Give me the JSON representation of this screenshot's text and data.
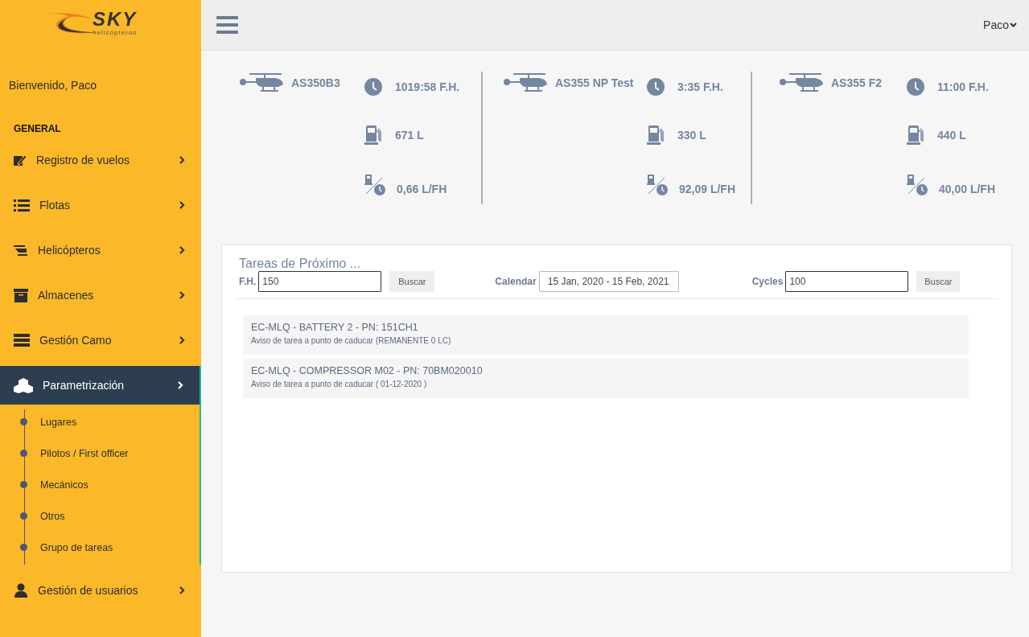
{
  "logo": {
    "name": "SKY",
    "tagline": "helicópteros"
  },
  "welcome": "Bienvenido, Paco",
  "section_heading": "GENERAL",
  "menu": [
    {
      "label": "Registro de vuelos",
      "selected": false
    },
    {
      "label": "Flotas",
      "selected": false
    },
    {
      "label": "Helicópteros",
      "selected": false
    },
    {
      "label": "Almacenes",
      "selected": false
    },
    {
      "label": "Gestión Camo",
      "selected": false
    },
    {
      "label": "Parametrización",
      "selected": true,
      "children": [
        {
          "label": "Lugares"
        },
        {
          "label": "Pilotos / First officer"
        },
        {
          "label": "Mecánicos"
        },
        {
          "label": "Otros"
        },
        {
          "label": "Grupo de tareas"
        }
      ]
    },
    {
      "label": "Gestión de usuarios",
      "selected": false
    }
  ],
  "user_menu": "Paco",
  "aircraft": [
    {
      "name": "AS350B3",
      "hours": "1019:58 F.H.",
      "fuel": "671 L",
      "consumption": "0,66 L/FH"
    },
    {
      "name": "AS355 NP Test",
      "hours": "3:35 F.H.",
      "fuel": "330 L",
      "consumption": "92,09 L/FH"
    },
    {
      "name": "AS355 F2",
      "hours": "11:00 F.H.",
      "fuel": "440 L",
      "consumption": "40,00 L/FH"
    }
  ],
  "tasks_panel": {
    "title": "Tareas de Próximo ...",
    "filters": [
      {
        "label": "F.H.",
        "value": "150",
        "button": "Buscar"
      },
      {
        "label": "Calendar",
        "value": "15 Jan, 2020 - 15 Feb, 2021"
      },
      {
        "label": "Cycles",
        "value": "100",
        "button": "Buscar"
      }
    ],
    "tasks": [
      {
        "title": "EC-MLQ - BATTERY 2 - PN: 151CH1",
        "detail": "Aviso de tarea a punto de caducar (REMANENTE 0 LC)"
      },
      {
        "title": "EC-MLQ - COMPRESSOR M02 - PN: 70BM020010",
        "detail": "Aviso de tarea a punto de caducar ( 01-12-2020 )"
      }
    ]
  }
}
